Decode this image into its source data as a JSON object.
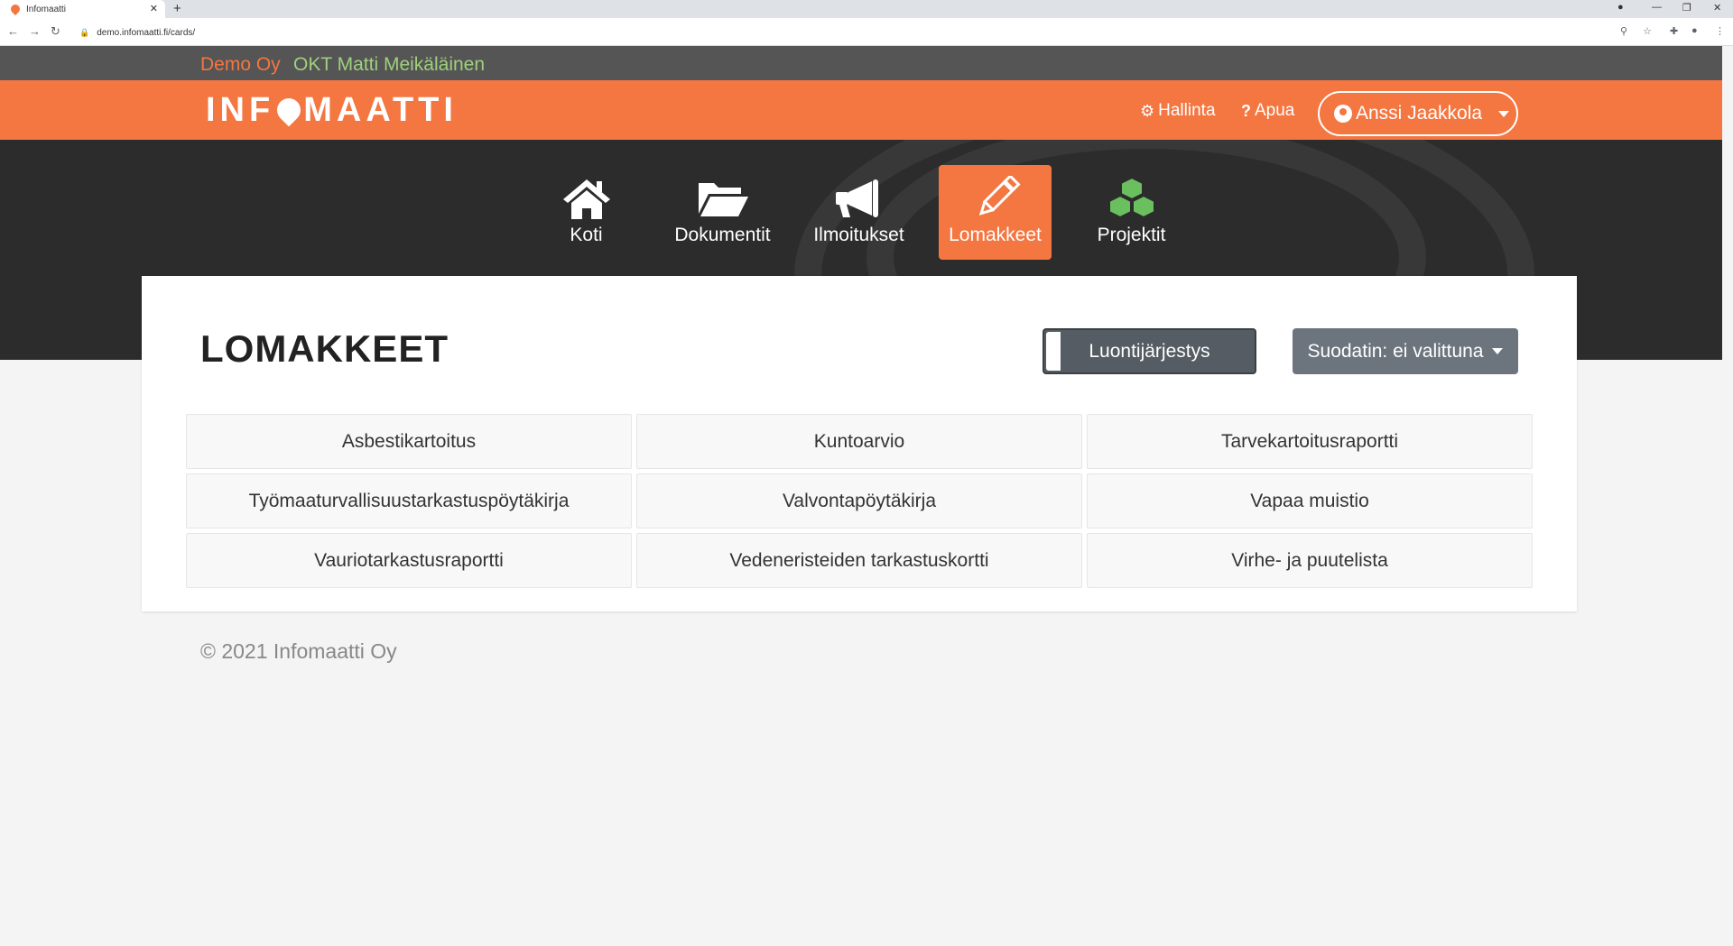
{
  "browser": {
    "tab_title": "Infomaatti",
    "url": "demo.infomaatti.fi/cards/"
  },
  "company": {
    "name": "Demo Oy",
    "building": "OKT Matti Meikäläinen"
  },
  "header": {
    "logo_text_1": "INF",
    "logo_text_2": "MAATTI",
    "admin_label": "Hallinta",
    "help_label": "Apua",
    "user_name": "Anssi Jaakkola"
  },
  "nav": {
    "items": [
      {
        "label": "Koti",
        "icon": "home-icon"
      },
      {
        "label": "Dokumentit",
        "icon": "folder-icon"
      },
      {
        "label": "Ilmoitukset",
        "icon": "megaphone-icon"
      },
      {
        "label": "Lomakkeet",
        "icon": "pencil-icon",
        "active": true
      },
      {
        "label": "Projektit",
        "icon": "cubes-icon"
      }
    ]
  },
  "main": {
    "title": "LOMAKKEET",
    "sort_label": "Luontijärjestys",
    "filter_label": "Suodatin: ei valittuna",
    "forms": [
      "Asbestikartoitus",
      "Kuntoarvio",
      "Tarvekartoitusraportti",
      "Työmaaturvallisuustarkastuspöytäkirja",
      "Valvontapöytäkirja",
      "Vapaa muistio",
      "Vauriotarkastusraportti",
      "Vedeneristeiden tarkastuskortti",
      "Virhe- ja puutelista"
    ]
  },
  "footer": {
    "copyright": "© 2021 Infomaatti Oy"
  },
  "colors": {
    "brand": "#f47641",
    "dark": "#2c2c2c",
    "project_green": "#6abf5e"
  }
}
